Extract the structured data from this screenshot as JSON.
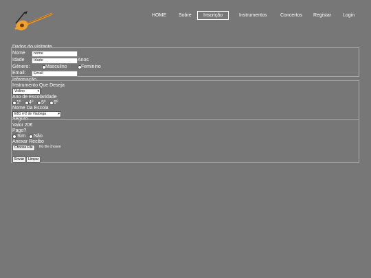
{
  "nav": {
    "items": [
      "HOME",
      "Sobre",
      "Inscrição",
      "Instrumentos",
      "Concertos",
      "Registar",
      "Login"
    ],
    "active": "Inscrição"
  },
  "visitante": {
    "legend": "Dados do visitante",
    "nome_label": "Nome",
    "nome_value": "nome",
    "idade_label": "Idade",
    "idade_value": "Idade",
    "anos_label": "Anos",
    "genero_label": "Género:",
    "genero_options": [
      "Masculino",
      "Feminino"
    ],
    "email_label": "Email:",
    "email_value": "Email"
  },
  "informacao": {
    "legend": "Informação",
    "instrumento_label": "Instrumento Que Deseja",
    "instrumento_value": "Violino",
    "ano_label": "Ano de Escolaridade",
    "ano_options": [
      "1º",
      "4º",
      "5º",
      "6º"
    ],
    "escola_label": "Nome Da Escola",
    "escola_value": "EB1 nº2 de Vialonga"
  },
  "seguro": {
    "legend": "Seguro",
    "valor_label": "Valor 20€",
    "pago_label": "Pago?",
    "pago_options": [
      "Sim",
      "Não"
    ],
    "recibo_label": "Anexar Recibo",
    "file_button": "Choose File",
    "file_status": "No file chosen"
  },
  "actions": {
    "submit": "Enviar",
    "reset": "Limpar"
  },
  "colors": {
    "background": "#777777",
    "logo_accent": "#f0a030"
  }
}
